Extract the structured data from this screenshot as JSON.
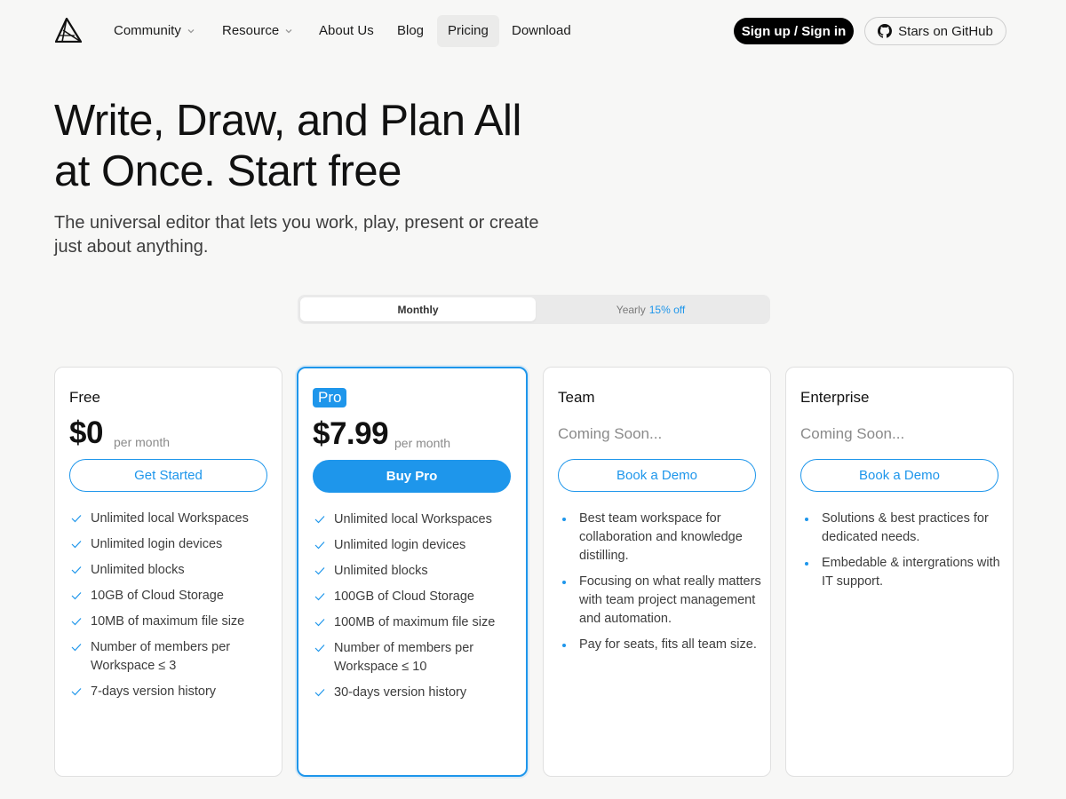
{
  "nav": {
    "items": [
      {
        "label": "Community",
        "dropdown": true
      },
      {
        "label": "Resource",
        "dropdown": true
      },
      {
        "label": "About Us"
      },
      {
        "label": "Blog"
      },
      {
        "label": "Pricing",
        "active": true
      },
      {
        "label": "Download"
      }
    ],
    "signup_label": "Sign up / Sign in",
    "github_label": "Stars on GitHub"
  },
  "hero": {
    "title_line1": "Write, Draw, and Plan All",
    "title_line2": "at Once. Start free",
    "subtitle_line1": "The universal editor that lets you work, play, present or create",
    "subtitle_line2": "just about anything."
  },
  "billing_toggle": {
    "monthly": "Monthly",
    "yearly": "Yearly",
    "yearly_discount": "15% off",
    "selected": "Monthly"
  },
  "plans": [
    {
      "name": "Free",
      "price": "$0",
      "period": "per month",
      "cta": "Get Started",
      "features": [
        "Unlimited local Workspaces",
        "Unlimited login devices",
        "Unlimited blocks",
        "10GB of Cloud Storage",
        "10MB of maximum file size",
        "Number of members per Workspace ≤ 3",
        "7-days version history"
      ]
    },
    {
      "name": "Pro",
      "price": "$7.99",
      "period": "per month",
      "cta": "Buy Pro",
      "features": [
        "Unlimited local Workspaces",
        "Unlimited login devices",
        "Unlimited blocks",
        "100GB of Cloud Storage",
        "100MB of maximum file size",
        "Number of members per Workspace ≤ 10",
        "30-days version history"
      ]
    },
    {
      "name": "Team",
      "status": "Coming Soon...",
      "cta": "Book a Demo",
      "features": [
        "Best team workspace for collaboration and knowledge distilling.",
        "Focusing on what really matters with team project management and automation.",
        "Pay for seats, fits all team size."
      ]
    },
    {
      "name": "Enterprise",
      "status": "Coming Soon...",
      "cta": "Book a Demo",
      "features": [
        "Solutions & best practices for dedicated needs.",
        "Embedable & intergrations with IT support."
      ]
    }
  ],
  "colors": {
    "accent": "#1e96eb",
    "background": "#f7f7f6",
    "text": "#1b1b1b"
  }
}
